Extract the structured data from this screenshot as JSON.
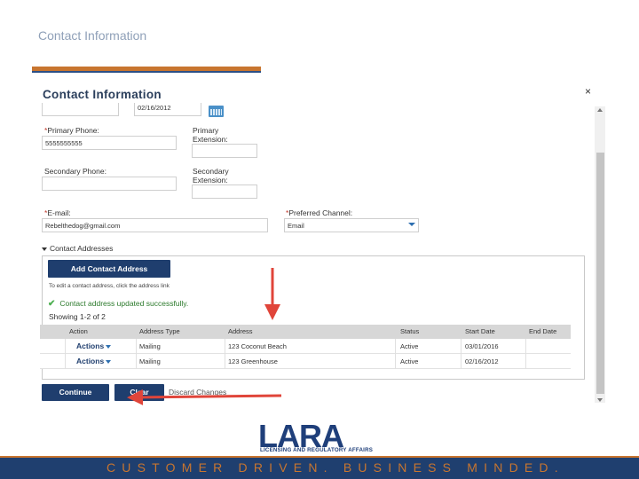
{
  "slide": {
    "title": "Contact Information",
    "footer": "CUSTOMER DRIVEN. BUSINESS MINDED.",
    "logo": {
      "mark": "LARA",
      "subtitle": "LICENSING AND REGULATORY AFFAIRS"
    },
    "colors": {
      "accent_orange": "#c8752f",
      "brand_navy": "#1f3f6f",
      "title_gray_blue": "#8fa0b8"
    }
  },
  "dialog": {
    "title": "Contact Information",
    "close_glyph": "×",
    "date_value": "02/16/2012",
    "primary_phone": {
      "label": "Primary Phone:",
      "value": "5555555555"
    },
    "primary_extension": {
      "label": "Primary Extension:",
      "value": ""
    },
    "secondary_phone": {
      "label": "Secondary Phone:",
      "value": ""
    },
    "secondary_extension": {
      "label": "Secondary Extension:",
      "value": ""
    },
    "email": {
      "label": "E-mail:",
      "value": "Rebelthedog@gmail.com"
    },
    "preferred_channel": {
      "label": "Preferred Channel:",
      "value": "Email"
    },
    "required_marker": "*",
    "addresses": {
      "section_label": "Contact Addresses",
      "add_button": "Add Contact Address",
      "hint": "To edit a contact address, click the address link",
      "success": "Contact address updated successfully.",
      "showing": "Showing 1-2 of 2",
      "columns": [
        "Action",
        "Address Type",
        "Address",
        "Status",
        "Start Date",
        "End Date"
      ],
      "rows": [
        {
          "action": "Actions",
          "type": "Mailing",
          "address": "123 Coconut Beach",
          "status": "Active",
          "start": "03/01/2016",
          "end": ""
        },
        {
          "action": "Actions",
          "type": "Mailing",
          "address": "123 Greenhouse",
          "status": "Active",
          "start": "02/16/2012",
          "end": ""
        }
      ]
    },
    "buttons": {
      "continue": "Continue",
      "clear": "Clear",
      "discard": "Discard Changes"
    }
  }
}
